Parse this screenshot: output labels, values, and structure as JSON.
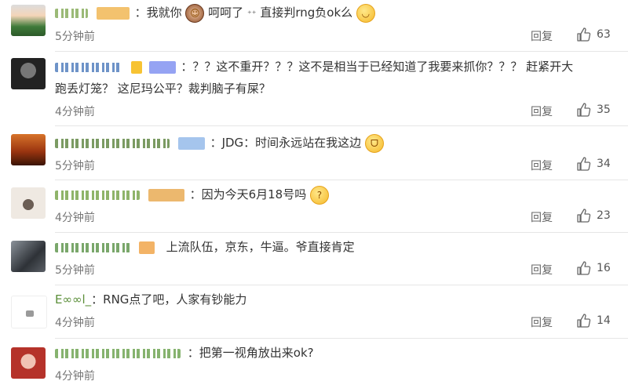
{
  "labels": {
    "reply": "回复"
  },
  "comments": [
    {
      "text": "：我就你",
      "text2": "呵呵了",
      "text3": "直接判rng负ok么",
      "time": "5分钟前",
      "likes": "63",
      "avatar_colors": [
        "#9c8f7a",
        "#c23b3b",
        "#f3d3b3"
      ]
    },
    {
      "text": "：？？这不重开？？？这不是相当于已经知道了我要来抓你？？？ 赶紧开大",
      "text_line2": "跑丢灯笼？ 这尼玛公平？裁判脑子有屎？",
      "time": "4分钟前",
      "likes": "35",
      "avatar_colors": [
        "#2b2b2b",
        "#555555",
        "#8a8a8a"
      ]
    },
    {
      "text": "：JDG：时间永远站在我这边",
      "time": "5分钟前",
      "likes": "34",
      "avatar_colors": [
        "#7a1e0d",
        "#c8541f",
        "#e7a15b"
      ]
    },
    {
      "text": "：因为今天6月18号吗",
      "time": "4分钟前",
      "likes": "23",
      "avatar_colors": [
        "#d9d3cc",
        "#6b5e55",
        "#f2efe9"
      ]
    },
    {
      "text": "上流队伍，京东，牛逼。爷直接肯定",
      "time": "5分钟前",
      "likes": "16",
      "avatar_colors": [
        "#5a5f66",
        "#2e3237",
        "#8b929a"
      ]
    },
    {
      "prefix": "E∞∞l_",
      "text": "：RNG点了吧，人家有钞能力",
      "time": "4分钟前",
      "likes": "14",
      "avatar_colors": [
        "#ffffff",
        "#d5d5d5",
        "#8c8c8c"
      ]
    },
    {
      "text": "：把第一视角放出来ok?",
      "time": "4分钟前",
      "likes": "",
      "avatar_colors": [
        "#b5322a",
        "#e48a7a",
        "#f1c3b5"
      ]
    }
  ]
}
